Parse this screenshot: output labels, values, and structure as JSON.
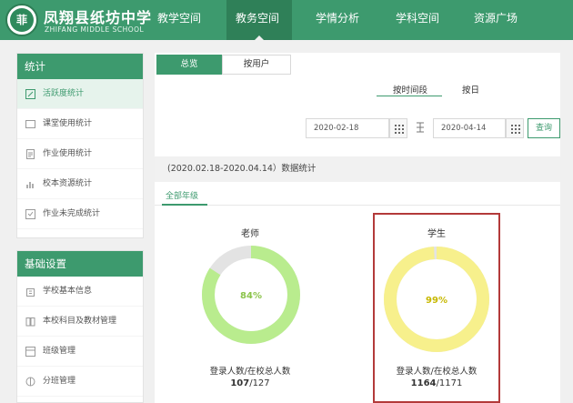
{
  "header": {
    "logo_char": "菲",
    "school_name": "凤翔县纸坊中学",
    "school_en": "ZHIFANG MIDDLE SCHOOL",
    "nav": [
      "教学空间",
      "教务空间",
      "学情分析",
      "学科空间",
      "资源广场"
    ],
    "active_nav": "教务空间"
  },
  "sidebar": {
    "stats": {
      "title": "统计",
      "items": [
        "活跃度统计",
        "课堂使用统计",
        "作业使用统计",
        "校本资源统计",
        "作业未完成统计"
      ]
    },
    "settings": {
      "title": "基础设置",
      "items": [
        "学校基本信息",
        "本校科目及教材管理",
        "班级管理",
        "分班管理"
      ]
    }
  },
  "main": {
    "tabs": [
      "总览",
      "按用户"
    ],
    "mode": [
      "按时间段",
      "按日"
    ],
    "start_date": "2020-02-18",
    "end_date": "2020-04-14",
    "query_label": "查询",
    "range_text": "(2020.02.18-2020.04.14）数据统计",
    "grade_tab": "全部年级",
    "stats": [
      {
        "title": "老师",
        "percent_label": "84%",
        "percent": 0.84,
        "subtitle": "登录人数/在校总人数",
        "logged": "107",
        "total": "/127"
      },
      {
        "title": "学生",
        "percent_label": "99%",
        "percent": 0.99,
        "subtitle": "登录人数/在校总人数",
        "logged": "1164",
        "total": "/1171"
      }
    ]
  },
  "colors": {
    "brand_green": "#3d9a6e",
    "teacher_ring": "#b9ec8e",
    "teacher_ring_bg": "#e3e3e3",
    "teacher_text": "#8bc34a",
    "student_ring": "#f7f08c",
    "student_ring_bg": "#e3e3e3",
    "student_text": "#c7b800",
    "highlight_border": "#b33a3a"
  }
}
